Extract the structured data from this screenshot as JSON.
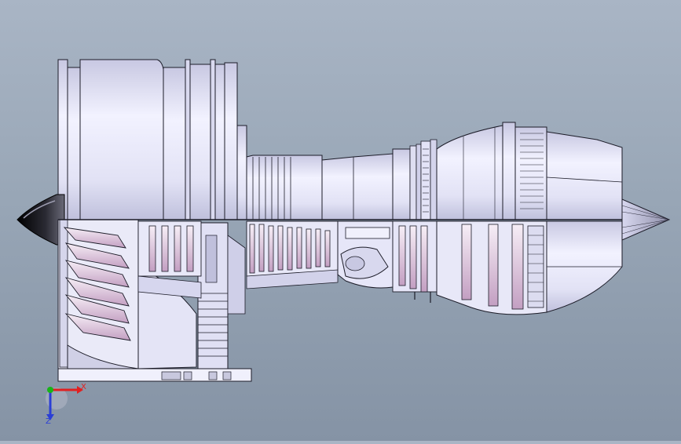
{
  "viewport": {
    "background_top": "#a9b5c5",
    "background_bottom": "#8593a5",
    "model": "turbofan-engine-cutaway"
  },
  "colors": {
    "part_fill": "#e6e6f8",
    "part_light": "#f4f4ff",
    "part_shade": "#c3c3dd",
    "edge": "#1c1c28",
    "blade_tint": "#c9a7c7",
    "cone_dark": "#0d0d12"
  },
  "triad": {
    "x_label": "X",
    "z_label": "Z",
    "x_color": "#e12020",
    "y_color": "#18b418",
    "z_color": "#2a3ed6",
    "icon": "coordinate-triad-icon"
  }
}
